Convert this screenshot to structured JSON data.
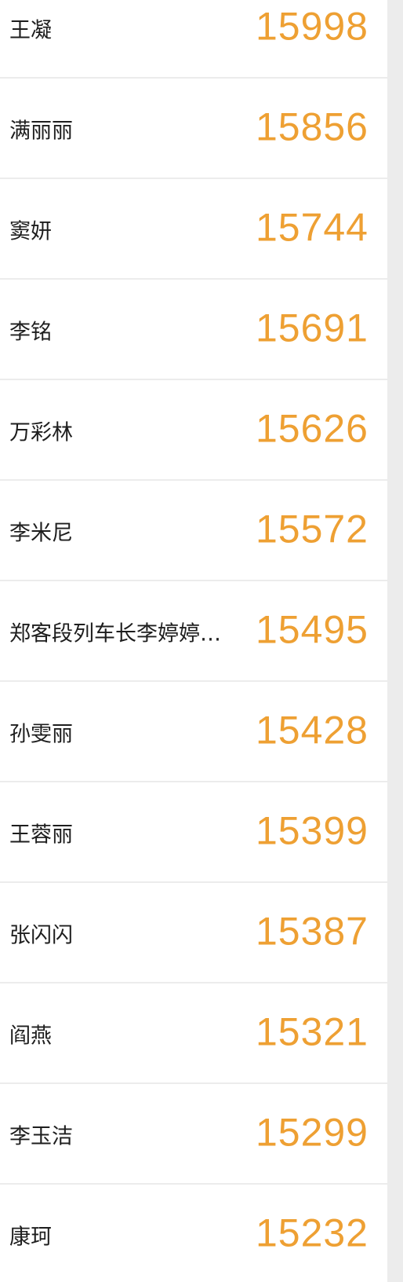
{
  "ranking": {
    "accent_color": "#eea033",
    "rows": [
      {
        "name": "王凝",
        "score": "15998"
      },
      {
        "name": "满丽丽",
        "score": "15856"
      },
      {
        "name": "窦妍",
        "score": "15744"
      },
      {
        "name": "李铭",
        "score": "15691"
      },
      {
        "name": "万彩林",
        "score": "15626"
      },
      {
        "name": "李米尼",
        "score": "15572"
      },
      {
        "name": "郑客段列车长李婷婷…",
        "score": "15495"
      },
      {
        "name": "孙雯丽",
        "score": "15428"
      },
      {
        "name": "王蓉丽",
        "score": "15399"
      },
      {
        "name": "张闪闪",
        "score": "15387"
      },
      {
        "name": "阎燕",
        "score": "15321"
      },
      {
        "name": "李玉洁",
        "score": "15299"
      },
      {
        "name": "康珂",
        "score": "15232"
      }
    ]
  }
}
